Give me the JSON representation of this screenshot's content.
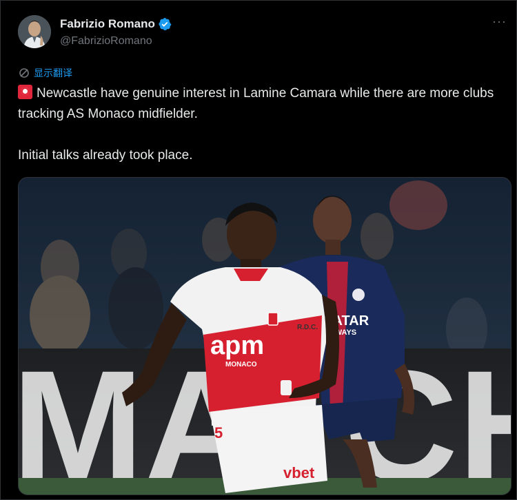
{
  "author": {
    "name": "Fabrizio Romano",
    "handle": "@FabrizioRomano",
    "verified": true
  },
  "header": {
    "more_icon": "more-dots-icon",
    "more_label": "···"
  },
  "translate": {
    "label": "显示翻译",
    "icon": "translate-icon"
  },
  "tweet": {
    "line1": "Newcastle have genuine interest in Lamine Camara while there are more clubs tracking AS Monaco midfielder.",
    "line2": "Initial talks already took place.",
    "emoji": "rotating-light-icon"
  },
  "media": {
    "jersey_sponsor": "apm",
    "jersey_sponsor_sub": "MONACO",
    "shorts_sponsor": "vbet",
    "shorts_number": "5",
    "psg_sponsor_1": "QATAR",
    "psg_sponsor_2": "AIRWAYS",
    "board_text": "MATCH",
    "sleeve_text": "R.D.C."
  },
  "colors": {
    "accent": "#1d9bf0",
    "text": "#e7e9ea",
    "secondary": "#71767b",
    "monaco_red": "#d62030",
    "psg_navy": "#1a2a5a"
  }
}
